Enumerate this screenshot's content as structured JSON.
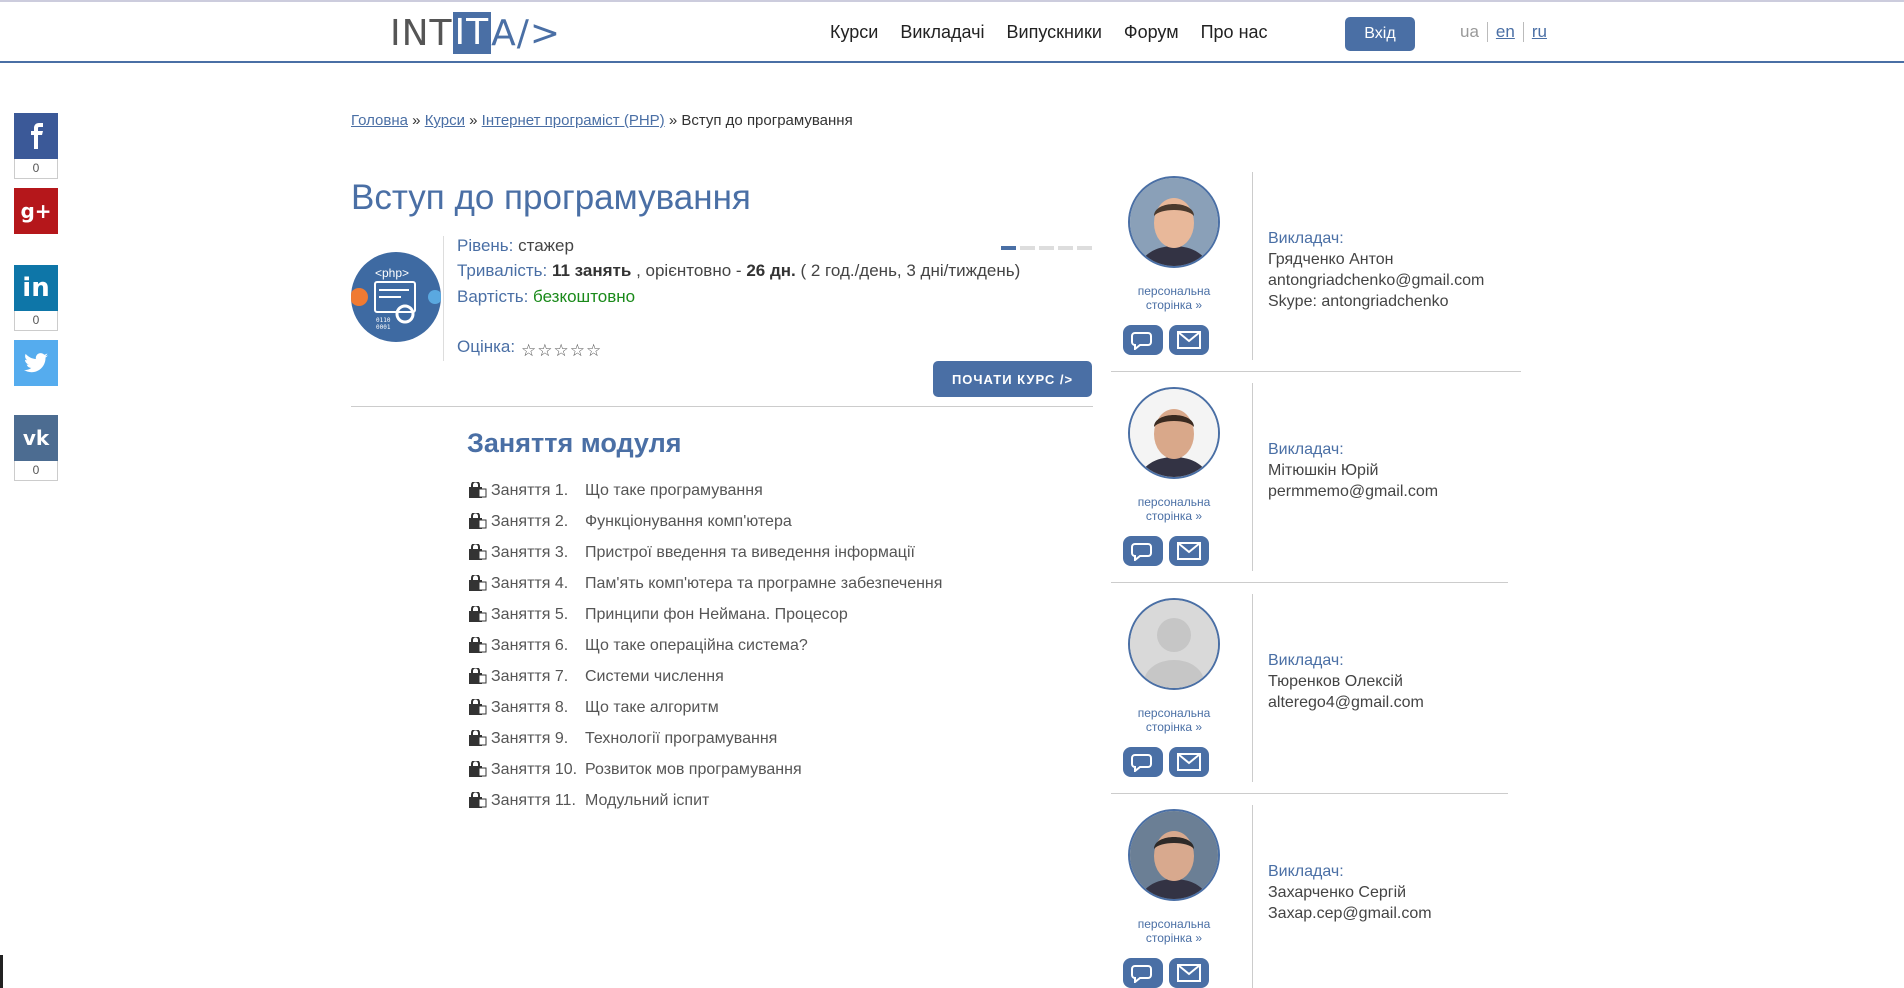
{
  "header": {
    "logo": {
      "left": "INT",
      "mid": "IT",
      "right": "A/>"
    },
    "nav": [
      "Курси",
      "Викладачі",
      "Випускники",
      "Форум",
      "Про нас"
    ],
    "login_label": "Вхід",
    "langs": {
      "current": "ua",
      "en": "en",
      "ru": "ru"
    }
  },
  "social": {
    "facebook": {
      "count": "0"
    },
    "linkedin": {
      "count": "0"
    },
    "vk": {
      "count": "0"
    }
  },
  "breadcrumb": {
    "home": "Головна",
    "courses": "Курси",
    "course": "Інтернет програміст (PHP)",
    "current": "Вступ до програмування",
    "sep": "»"
  },
  "course": {
    "title": "Вступ до програмування",
    "icon_label": "<php>",
    "level_label": "Рівень:",
    "level_value": "стажер",
    "level_steps": 5,
    "level_filled": 1,
    "duration_label": "Тривалість:",
    "duration_lessons": "11 занять",
    "duration_mid": ", орієнтовно -",
    "duration_days": "26 дн.",
    "duration_note": "( 2 год./день, 3 дні/тиждень)",
    "price_label": "Вартість:",
    "price_value": "безкоштовно",
    "rating_label": "Оцінка:",
    "rating_stars": "☆☆☆☆☆",
    "start_label": "ПОЧАТИ КУРС />"
  },
  "module": {
    "title": "Заняття модуля",
    "lessons": [
      {
        "num": "Заняття 1.",
        "title": "Що таке програмування"
      },
      {
        "num": "Заняття 2.",
        "title": "Функціонування комп'ютера"
      },
      {
        "num": "Заняття 3.",
        "title": "Пристрої введення та виведення інформації"
      },
      {
        "num": "Заняття 4.",
        "title": "Пам'ять комп'ютера та програмне забезпечення"
      },
      {
        "num": "Заняття 5.",
        "title": "Принципи фон Неймана. Процесор"
      },
      {
        "num": "Заняття 6.",
        "title": "Що таке операційна система?"
      },
      {
        "num": "Заняття 7.",
        "title": "Системи числення"
      },
      {
        "num": "Заняття 8.",
        "title": "Що таке алгоритм"
      },
      {
        "num": "Заняття 9.",
        "title": "Технології програмування"
      },
      {
        "num": "Заняття 10.",
        "title": "Розвиток мов програмування"
      },
      {
        "num": "Заняття 11.",
        "title": "Модульний іспит"
      }
    ]
  },
  "teachers": [
    {
      "label": "Викладач:",
      "name": "Грядченко Антон",
      "email": "antongriadchenko@gmail.com",
      "extra": "Skype: antongriadchenko",
      "page_link": "персональна сторінка »"
    },
    {
      "label": "Викладач:",
      "name": "Мітюшкін Юрій",
      "email": "permmemo@gmail.com",
      "extra": "",
      "page_link": "персональна сторінка »"
    },
    {
      "label": "Викладач:",
      "name": "Тюренков Олексій",
      "email": "alterego4@gmail.com",
      "extra": "",
      "page_link": "персональна сторінка »"
    },
    {
      "label": "Викладач:",
      "name": "Захарченко Сергій",
      "email": "Захар.сер@gmail.com",
      "extra": "",
      "page_link": "персональна сторінка »"
    }
  ],
  "colors": {
    "accent": "#4a6fa5",
    "free": "#1a8a1a",
    "facebook": "#3b5998",
    "gplus": "#b5171b",
    "linkedin": "#0e76a8",
    "twitter": "#55acee",
    "vk": "#4c6c91"
  }
}
